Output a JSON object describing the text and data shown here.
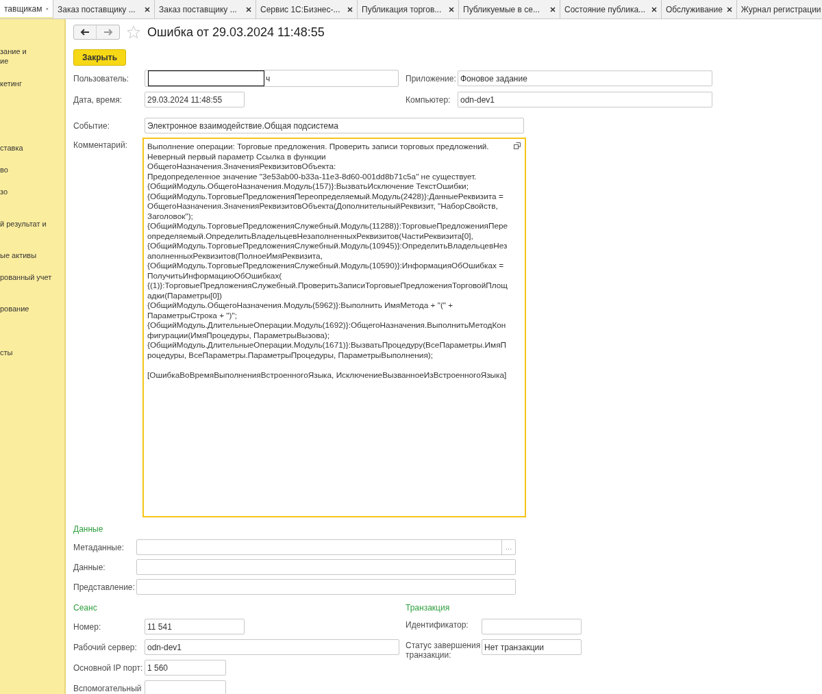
{
  "tabs": [
    {
      "label": "тавщикам",
      "closable": true,
      "selected": true
    },
    {
      "label": "Заказ поставщику ...",
      "closable": true,
      "selected": false
    },
    {
      "label": "Заказ поставщику ...",
      "closable": true,
      "selected": false
    },
    {
      "label": "Сервис 1С:Бизнес-...",
      "closable": true,
      "selected": false
    },
    {
      "label": "Публикация торгов...",
      "closable": true,
      "selected": false
    },
    {
      "label": "Публикуемые в се...",
      "closable": true,
      "selected": false
    },
    {
      "label": "Состояние публика...",
      "closable": true,
      "selected": false
    },
    {
      "label": "Обслуживание",
      "closable": true,
      "selected": false
    },
    {
      "label": "Журнал регистрации",
      "closable": false,
      "selected": false
    }
  ],
  "sidebar": {
    "items": [
      "зание и\nие",
      "кетинг",
      "ставка",
      "во",
      "зо",
      "й результат и",
      "ые активы",
      "рованный учет",
      "рование",
      "сты"
    ]
  },
  "title": "Ошибка от 29.03.2024 11:48:55",
  "close_button": "Закрыть",
  "user": {
    "label": "Пользователь:",
    "value": "ч"
  },
  "application": {
    "label": "Приложение:",
    "value": "Фоновое задание"
  },
  "datetime": {
    "label": "Дата, время:",
    "value": "29.03.2024 11:48:55"
  },
  "computer": {
    "label": "Компьютер:",
    "value": "odn-dev1"
  },
  "event": {
    "label": "Событие:",
    "value": "Электронное взаимодействие.Общая подсистема"
  },
  "comment": {
    "label": "Комментарий:",
    "value": "Выполнение операции: Торговые предложения. Проверить записи торговых предложений.\nНеверный первый параметр Ссылка в функции\nОбщегоНазначения.ЗначенияРеквизитовОбъекта:\nПредопределенное значение \"3e53ab00-b33a-11e3-8d60-001dd8b71c5a\" не существует.\n{ОбщийМодуль.ОбщегоНазначения.Модуль(157)}:ВызватьИсключение ТекстОшибки;\n{ОбщийМодуль.ТорговыеПредложенияПереопределяемый.Модуль(2428)}:ДанныеРеквизита = ОбщегоНазначения.ЗначенияРеквизитовОбъекта(ДополнительныйРеквизит, \"НаборСвойств, Заголовок\");\n{ОбщийМодуль.ТорговыеПредложенияСлужебный.Модуль(11288)}:ТорговыеПредложенияПереопределяемый.ОпределитьВладельцевНезаполненныхРеквизитов(ЧастиРеквизита[0],\n{ОбщийМодуль.ТорговыеПредложенияСлужебный.Модуль(10945)}:ОпределитьВладельцевНезаполненныхРеквизитов(ПолноеИмяРеквизита,\n{ОбщийМодуль.ТорговыеПредложенияСлужебный.Модуль(10590)}:ИнформацияОбОшибках = ПолучитьИнформациюОбОшибках(\n{(1)}:ТорговыеПредложенияСлужебный.ПроверитьЗаписиТорговыеПредложенияТорговойПлощадки(Параметры[0])\n{ОбщийМодуль.ОбщегоНазначения.Модуль(5962)}:Выполнить ИмяМетода + \"(\" + ПараметрыСтрока + \")\";\n{ОбщийМодуль.ДлительныеОперации.Модуль(1692)}:ОбщегоНазначения.ВыполнитьМетодКонфигурации(ИмяПроцедуры, ПараметрыВызова);\n{ОбщийМодуль.ДлительныеОперации.Модуль(1671)}:ВызватьПроцедуру(ВсеПараметры.ИмяПроцедуры, ВсеПараметры.ПараметрыПроцедуры, ПараметрыВыполнения);\n\n[ОшибкаВоВремяВыполненияВстроенногоЯзыка, ИсключениеВызванноеИзВстроенногоЯзыка]"
  },
  "data_section": {
    "title": "Данные",
    "fields": [
      {
        "label": "Метаданные:",
        "select_button": "…"
      },
      {
        "label": "Данные:"
      },
      {
        "label": "Представление:"
      }
    ]
  },
  "session": {
    "title": "Сеанс",
    "fields": [
      {
        "label": "Номер:",
        "value": "11 541"
      },
      {
        "label": "Рабочий сервер:",
        "value": "odn-dev1"
      },
      {
        "label": "Основной IP порт:",
        "value": "1 560"
      },
      {
        "label": "Вспомогательный"
      }
    ]
  },
  "transaction": {
    "title": "Транзакция",
    "fields": [
      {
        "label": "Идентификатор:"
      },
      {
        "label": "Статус завершения транзакции:",
        "value": "Нет транзакции"
      }
    ]
  }
}
